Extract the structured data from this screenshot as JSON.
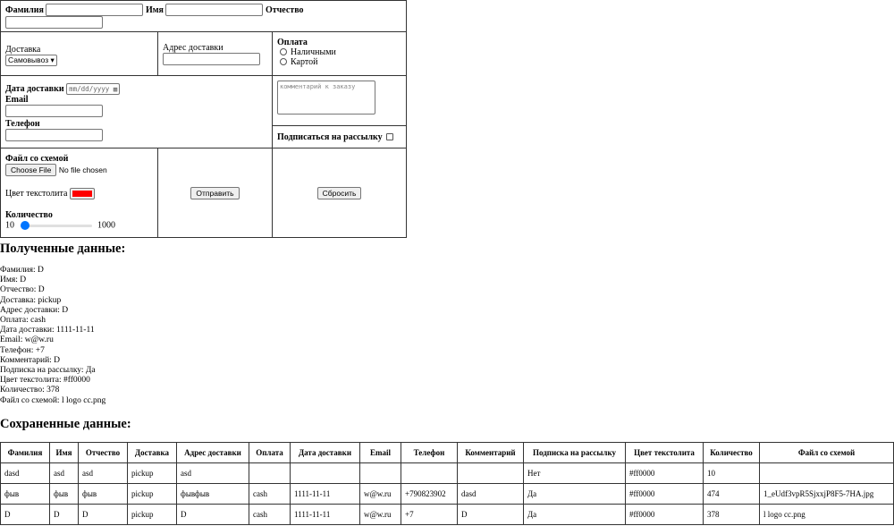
{
  "form": {
    "last_name_label": "Фамилия",
    "first_name_label": "Имя",
    "patronymic_label": "Отчество",
    "delivery_label": "Доставка",
    "delivery_value": "Самовывоз",
    "address_label": "Адрес доставки",
    "payment_label": "Оплата",
    "payment_options": [
      "Наличными",
      "Картой"
    ],
    "date_label": "Дата доставки",
    "date_placeholder": "mm/dd/yyyy",
    "email_label": "Email",
    "phone_label": "Телефон",
    "comment_placeholder": "комментарий к заказу",
    "subscribe_label": "Подписаться на рассылку",
    "file_label": "Файл со схемой",
    "file_button": "Choose File",
    "file_status": "No file chosen",
    "color_label": "Цвет текстолита",
    "color_value": "#ff0000",
    "quantity_label": "Количество",
    "quantity_min": "10",
    "quantity_max": "1000",
    "submit_label": "Отправить",
    "reset_label": "Сбросить"
  },
  "received": {
    "title": "Полученные данные:",
    "lines": [
      "Фамилия: D",
      "Имя: D",
      "Отчество: D",
      "Доставка: pickup",
      "Адрес доставки: D",
      "Оплата: cash",
      "Дата доставки: 1111-11-11",
      "Email: w@w.ru",
      "Телефон: +7",
      "Комментарий: D",
      "Подписка на рассылку: Да",
      "Цвет текстолита: #ff0000",
      "Количество: 378",
      "Файл со схемой: l logo cc.png"
    ]
  },
  "saved": {
    "title": "Сохраненные данные:",
    "headers": [
      "Фамилия",
      "Имя",
      "Отчество",
      "Доставка",
      "Адрес доставки",
      "Оплата",
      "Дата доставки",
      "Email",
      "Телефон",
      "Комментарий",
      "Подписка на рассылку",
      "Цвет текстолита",
      "Количество",
      "Файл со схемой"
    ],
    "rows": [
      [
        "dasd",
        "asd",
        "asd",
        "pickup",
        "asd",
        "",
        "",
        "",
        "",
        "",
        "Нет",
        "#ff0000",
        "10",
        ""
      ],
      [
        "фыв",
        "фыв",
        "фыв",
        "pickup",
        "фывфыв",
        "cash",
        "1111-11-11",
        "w@w.ru",
        "+790823902",
        "dasd",
        "Да",
        "#ff0000",
        "474",
        "1_eUdf3vpR5SjxxjP8F5-7HA.jpg"
      ],
      [
        "D",
        "D",
        "D",
        "pickup",
        "D",
        "cash",
        "1111-11-11",
        "w@w.ru",
        "+7",
        "D",
        "Да",
        "#ff0000",
        "378",
        "l logo cc.png"
      ]
    ]
  }
}
